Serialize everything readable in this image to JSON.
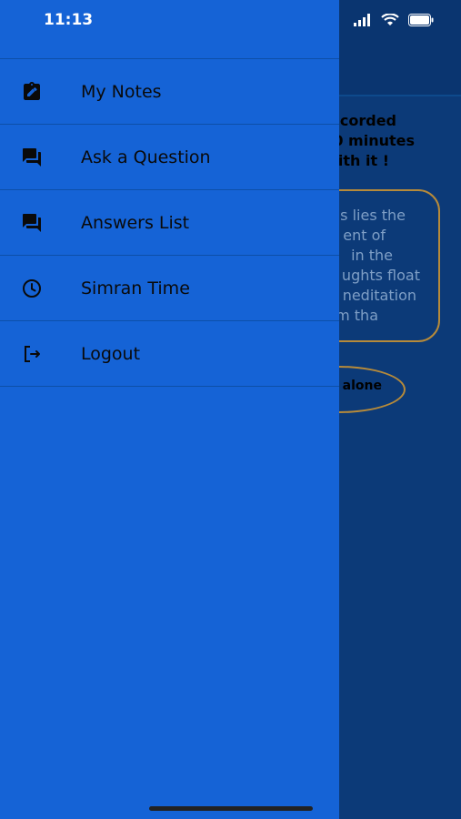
{
  "status_bar": {
    "time": "11:13"
  },
  "drawer": {
    "items": [
      {
        "label": "My Notes",
        "icon": "clipboard-edit-icon"
      },
      {
        "label": "Ask a Question",
        "icon": "forum-icon"
      },
      {
        "label": "Answers List",
        "icon": "forum-icon"
      },
      {
        "label": "Simran Time",
        "icon": "clock-icon"
      },
      {
        "label": "Logout",
        "icon": "logout-icon"
      }
    ]
  },
  "background": {
    "info_lines": [
      "corded",
      "0 minutes",
      "vith it !"
    ],
    "card_lines": [
      "s lies the",
      "ent of",
      "in the",
      "ughts float",
      "neditation",
      "m tha"
    ],
    "pill_label": "alone"
  },
  "colors": {
    "drawer": "#1563d6",
    "background": "#0c3a78",
    "border_accent": "#b68a3a"
  }
}
